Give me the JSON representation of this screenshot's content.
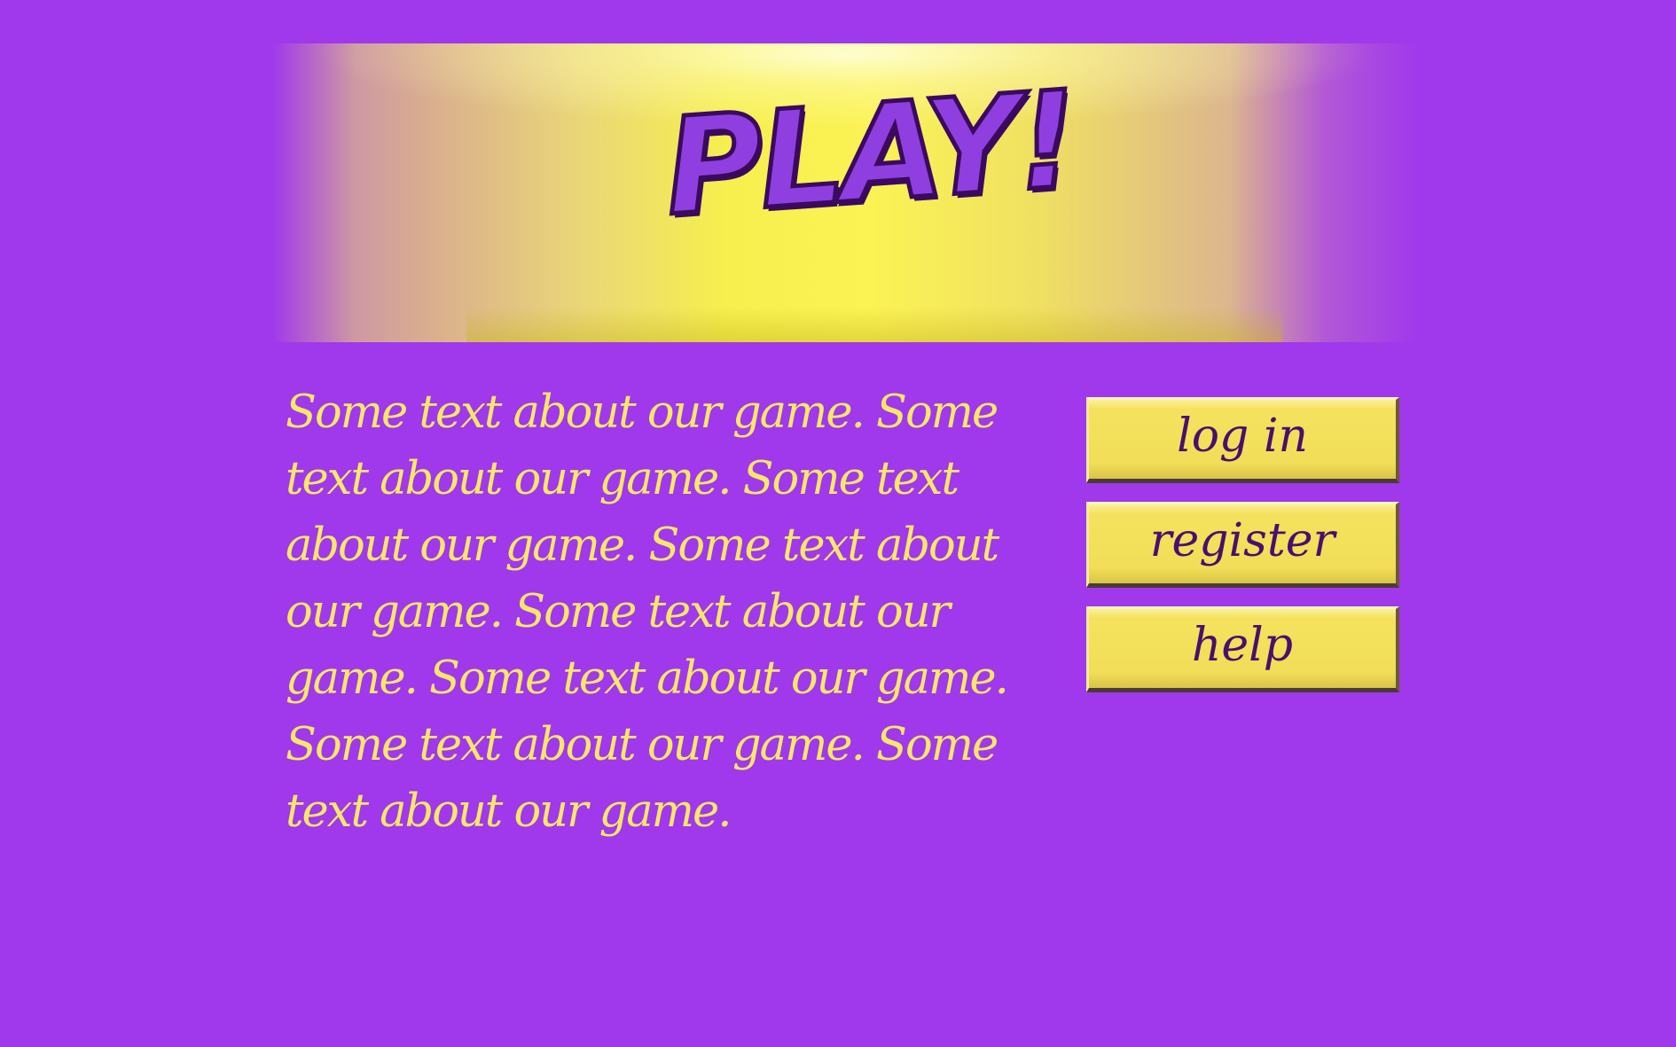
{
  "banner": {
    "logo_text": "PLAY!"
  },
  "main": {
    "description": "Some text about our game. Some text about our game. Some text about our game. Some text about our game. Some text about our game. Some text about our game. Some text about our game. Some text about our game."
  },
  "menu": {
    "login_label": "log in",
    "register_label": "register",
    "help_label": "help"
  },
  "colors": {
    "background": "#a038eb",
    "banner_yellow": "#fbf354",
    "text_yellow": "#f7e86a",
    "button_yellow": "#f2de58",
    "button_text": "#4a0f6e",
    "logo_purple": "#8f3fe0"
  }
}
